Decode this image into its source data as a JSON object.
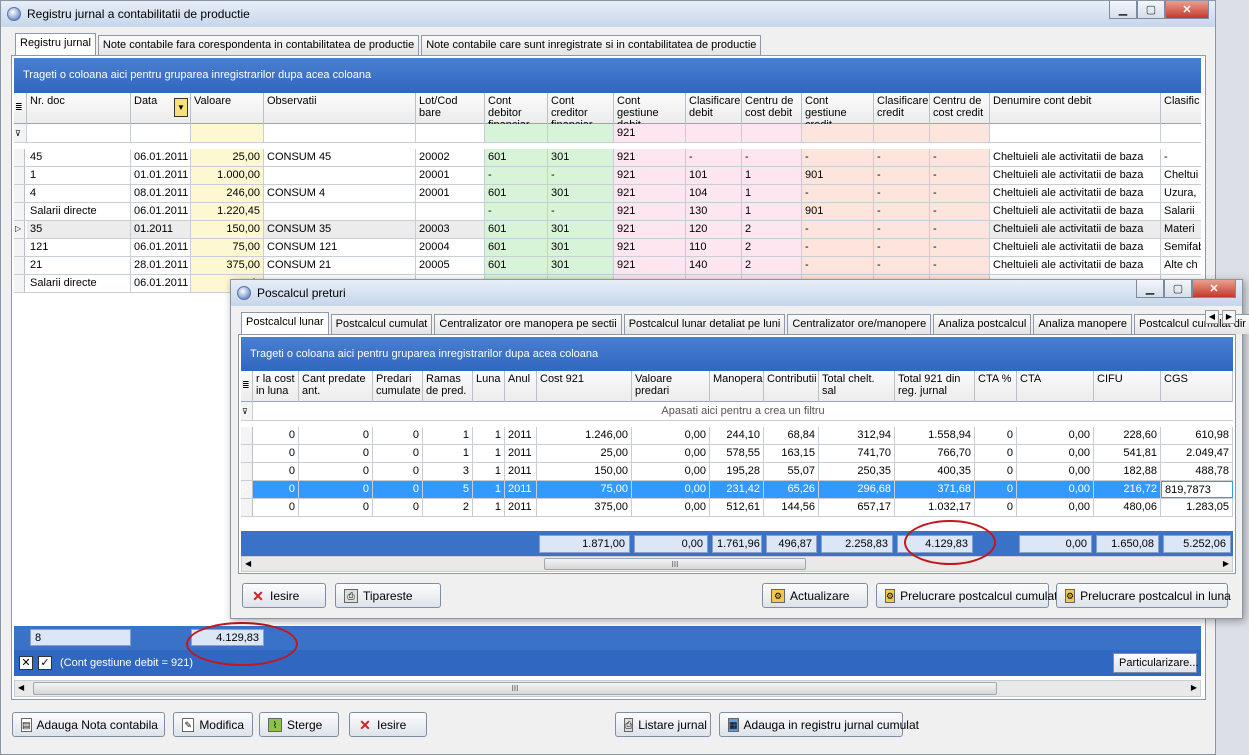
{
  "main": {
    "title": "Registru jurnal a contabilitatii de productie",
    "tabs": [
      "Registru jurnal",
      "Note contabile fara corespondenta in contabilitatea de productie",
      "Note contabile care sunt inregistrate si in contabilitatea de productie"
    ],
    "group_text": "Trageti o coloana aici pentru gruparea inregistrarilor dupa acea coloana",
    "headers": [
      "Nr. doc",
      "Data",
      "Valoare",
      "Observatii",
      "Lot/Cod bare",
      "Cont debitor financiar",
      "Cont creditor financiar",
      "Cont gestiune debit",
      "Clasificare debit",
      "Centru de cost debit",
      "Cont gestiune credit",
      "Clasificare credit",
      "Centru de cost credit",
      "Denumire cont debit",
      "Clasific"
    ],
    "filter_value": "921",
    "rows": [
      [
        "45",
        "06.01.2011",
        "25,00",
        "CONSUM 45",
        "20002",
        "601",
        "301",
        "921",
        "-",
        "-",
        "-",
        "-",
        "-",
        "Cheltuieli ale activitatii de baza",
        "-"
      ],
      [
        "1",
        "01.01.2011",
        "1.000,00",
        "",
        "20001",
        "-",
        "-",
        "921",
        "101",
        "1",
        "901",
        "-",
        "-",
        "Cheltuieli ale activitatii de baza",
        "Cheltui"
      ],
      [
        "4",
        "08.01.2011",
        "246,00",
        "CONSUM 4",
        "20001",
        "601",
        "301",
        "921",
        "104",
        "1",
        "-",
        "-",
        "-",
        "Cheltuieli ale activitatii de baza",
        "Uzura,"
      ],
      [
        "Salarii directe",
        "06.01.2011",
        "1.220,45",
        "",
        "",
        "-",
        "-",
        "921",
        "130",
        "1",
        "901",
        "-",
        "-",
        "Cheltuieli ale activitatii de baza",
        "Salarii"
      ],
      [
        "35",
        "01.2011",
        "150,00",
        "CONSUM 35",
        "20003",
        "601",
        "301",
        "921",
        "120",
        "2",
        "-",
        "-",
        "-",
        "Cheltuieli ale activitatii de baza",
        "Materi"
      ],
      [
        "121",
        "06.01.2011",
        "75,00",
        "CONSUM 121",
        "20004",
        "601",
        "301",
        "921",
        "110",
        "2",
        "-",
        "-",
        "-",
        "Cheltuieli ale activitatii de baza",
        "Semifab"
      ],
      [
        "21",
        "28.01.2011",
        "375,00",
        "CONSUM 21",
        "20005",
        "601",
        "301",
        "921",
        "140",
        "2",
        "-",
        "-",
        "-",
        "Cheltuieli ale activitatii de baza",
        "Alte ch"
      ],
      [
        "Salarii directe",
        "06.01.2011",
        "1.",
        "",
        "",
        "",
        "",
        "",
        "",
        "",
        "",
        "",
        "",
        "",
        ""
      ]
    ],
    "footer_count": "8",
    "footer_total": "4.129,83",
    "filter_status": "(Cont gestiune debit = 921)",
    "customize_label": "Particularizare...",
    "buttons": {
      "add": "Adauga Nota contabila",
      "edit": "Modifica",
      "delete": "Sterge",
      "exit": "Iesire",
      "list": "Listare jurnal",
      "add_cumul": "Adauga in registru jurnal cumulat"
    }
  },
  "popup": {
    "title": "Poscalcul preturi",
    "tabs": [
      "Postcalcul lunar",
      "Postcalcul cumulat",
      "Centralizator ore manopera pe sectii",
      "Postcalcul lunar detaliat pe luni",
      "Centralizator ore/manopere",
      "Analiza postcalcul",
      "Analiza manopere",
      "Postcalcul cumulat dir"
    ],
    "group_text": "Trageti o coloana aici pentru gruparea inregistrarilor dupa acea coloana",
    "headers": [
      "r la cost in luna",
      "Cant predate ant.",
      "Predari cumulate",
      "Ramas de pred.",
      "Luna",
      "Anul",
      "Cost 921",
      "Valoare predari",
      "Manopera",
      "Contributii",
      "Total chelt. sal",
      "Total 921 din reg. jurnal",
      "CTA %",
      "CTA",
      "CIFU",
      "CGS"
    ],
    "filter_hint": "Apasati aici pentru a crea un filtru",
    "rows": [
      [
        "0",
        "0",
        "0",
        "1",
        "1",
        "2011",
        "1.246,00",
        "0,00",
        "244,10",
        "68,84",
        "312,94",
        "1.558,94",
        "0",
        "0,00",
        "228,60",
        "610,98"
      ],
      [
        "0",
        "0",
        "0",
        "1",
        "1",
        "2011",
        "25,00",
        "0,00",
        "578,55",
        "163,15",
        "741,70",
        "766,70",
        "0",
        "0,00",
        "541,81",
        "2.049,47"
      ],
      [
        "0",
        "0",
        "0",
        "3",
        "1",
        "2011",
        "150,00",
        "0,00",
        "195,28",
        "55,07",
        "250,35",
        "400,35",
        "0",
        "0,00",
        "182,88",
        "488,78"
      ],
      [
        "0",
        "0",
        "0",
        "5",
        "1",
        "2011",
        "75,00",
        "0,00",
        "231,42",
        "65,26",
        "296,68",
        "371,68",
        "0",
        "0,00",
        "216,72",
        "819,7873"
      ],
      [
        "0",
        "0",
        "0",
        "2",
        "1",
        "2011",
        "375,00",
        "0,00",
        "512,61",
        "144,56",
        "657,17",
        "1.032,17",
        "0",
        "0,00",
        "480,06",
        "1.283,05"
      ]
    ],
    "totals": [
      "1.871,00",
      "0,00",
      "1.761,96",
      "496,87",
      "2.258,83",
      "4.129,83",
      "0,00",
      "1.650,08",
      "5.252,06"
    ],
    "buttons": {
      "exit": "Iesire",
      "print": "Tipareste",
      "update": "Actualizare",
      "cumul": "Prelucrare postcalcul cumulat",
      "monthly": "Prelucrare postcalcul in luna"
    }
  },
  "colors": {
    "accent": "#3a72c8",
    "highlight_row": "#3399ff",
    "annotation": "#c4161c"
  }
}
